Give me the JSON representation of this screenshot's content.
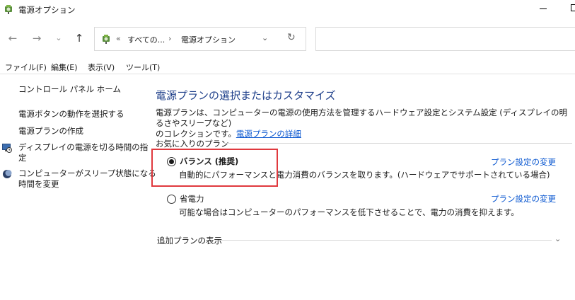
{
  "window": {
    "title": "電源オプション"
  },
  "nav": {
    "back": "←",
    "forward": "→",
    "recent": "⌄",
    "up": "↑"
  },
  "address": {
    "separator": "«",
    "crumb_parent": "すべての...",
    "crumb_arrow": "›",
    "crumb_current": "電源オプション",
    "dropdown": "⌄",
    "refresh": "↻"
  },
  "menu": {
    "file": "ファイル(F)",
    "edit": "編集(E)",
    "view": "表示(V)",
    "tools": "ツール(T)"
  },
  "sidebar": {
    "home": "コントロール パネル ホーム",
    "power_button": "電源ボタンの動作を選択する",
    "create_plan": "電源プランの作成",
    "display_off_line1": "ディスプレイの電源を切る時間の指",
    "display_off_line2": "定",
    "sleep_line1": "コンピューターがスリープ状態になる",
    "sleep_line2": "時間を変更"
  },
  "main": {
    "title": "電源プランの選択またはカスタマイズ",
    "desc_line1": "電源プランは、コンピューターの電源の使用方法を管理するハードウェア設定とシステム設定 (ディスプレイの明るさやスリープなど)",
    "desc_line2_prefix": "のコレクションです。",
    "desc_link": "電源プランの詳細",
    "favorites_header": "お気に入りのプラン",
    "plans": [
      {
        "name": "バランス (推奨)",
        "description": "自動的にパフォーマンスと電力消費のバランスを取ります。(ハードウェアでサポートされている場合)",
        "link": "プラン設定の変更",
        "selected": true
      },
      {
        "name": "省電力",
        "description": "可能な場合はコンピューターのパフォーマンスを低下させることで、電力の消費を抑えます。",
        "link": "プラン設定の変更",
        "selected": false
      }
    ],
    "more_plans": "追加プランの表示",
    "more_chevron": "⌄"
  },
  "colors": {
    "title_blue": "#1e3f8a",
    "link_blue": "#0a57d0",
    "highlight_red": "#e0393e"
  }
}
